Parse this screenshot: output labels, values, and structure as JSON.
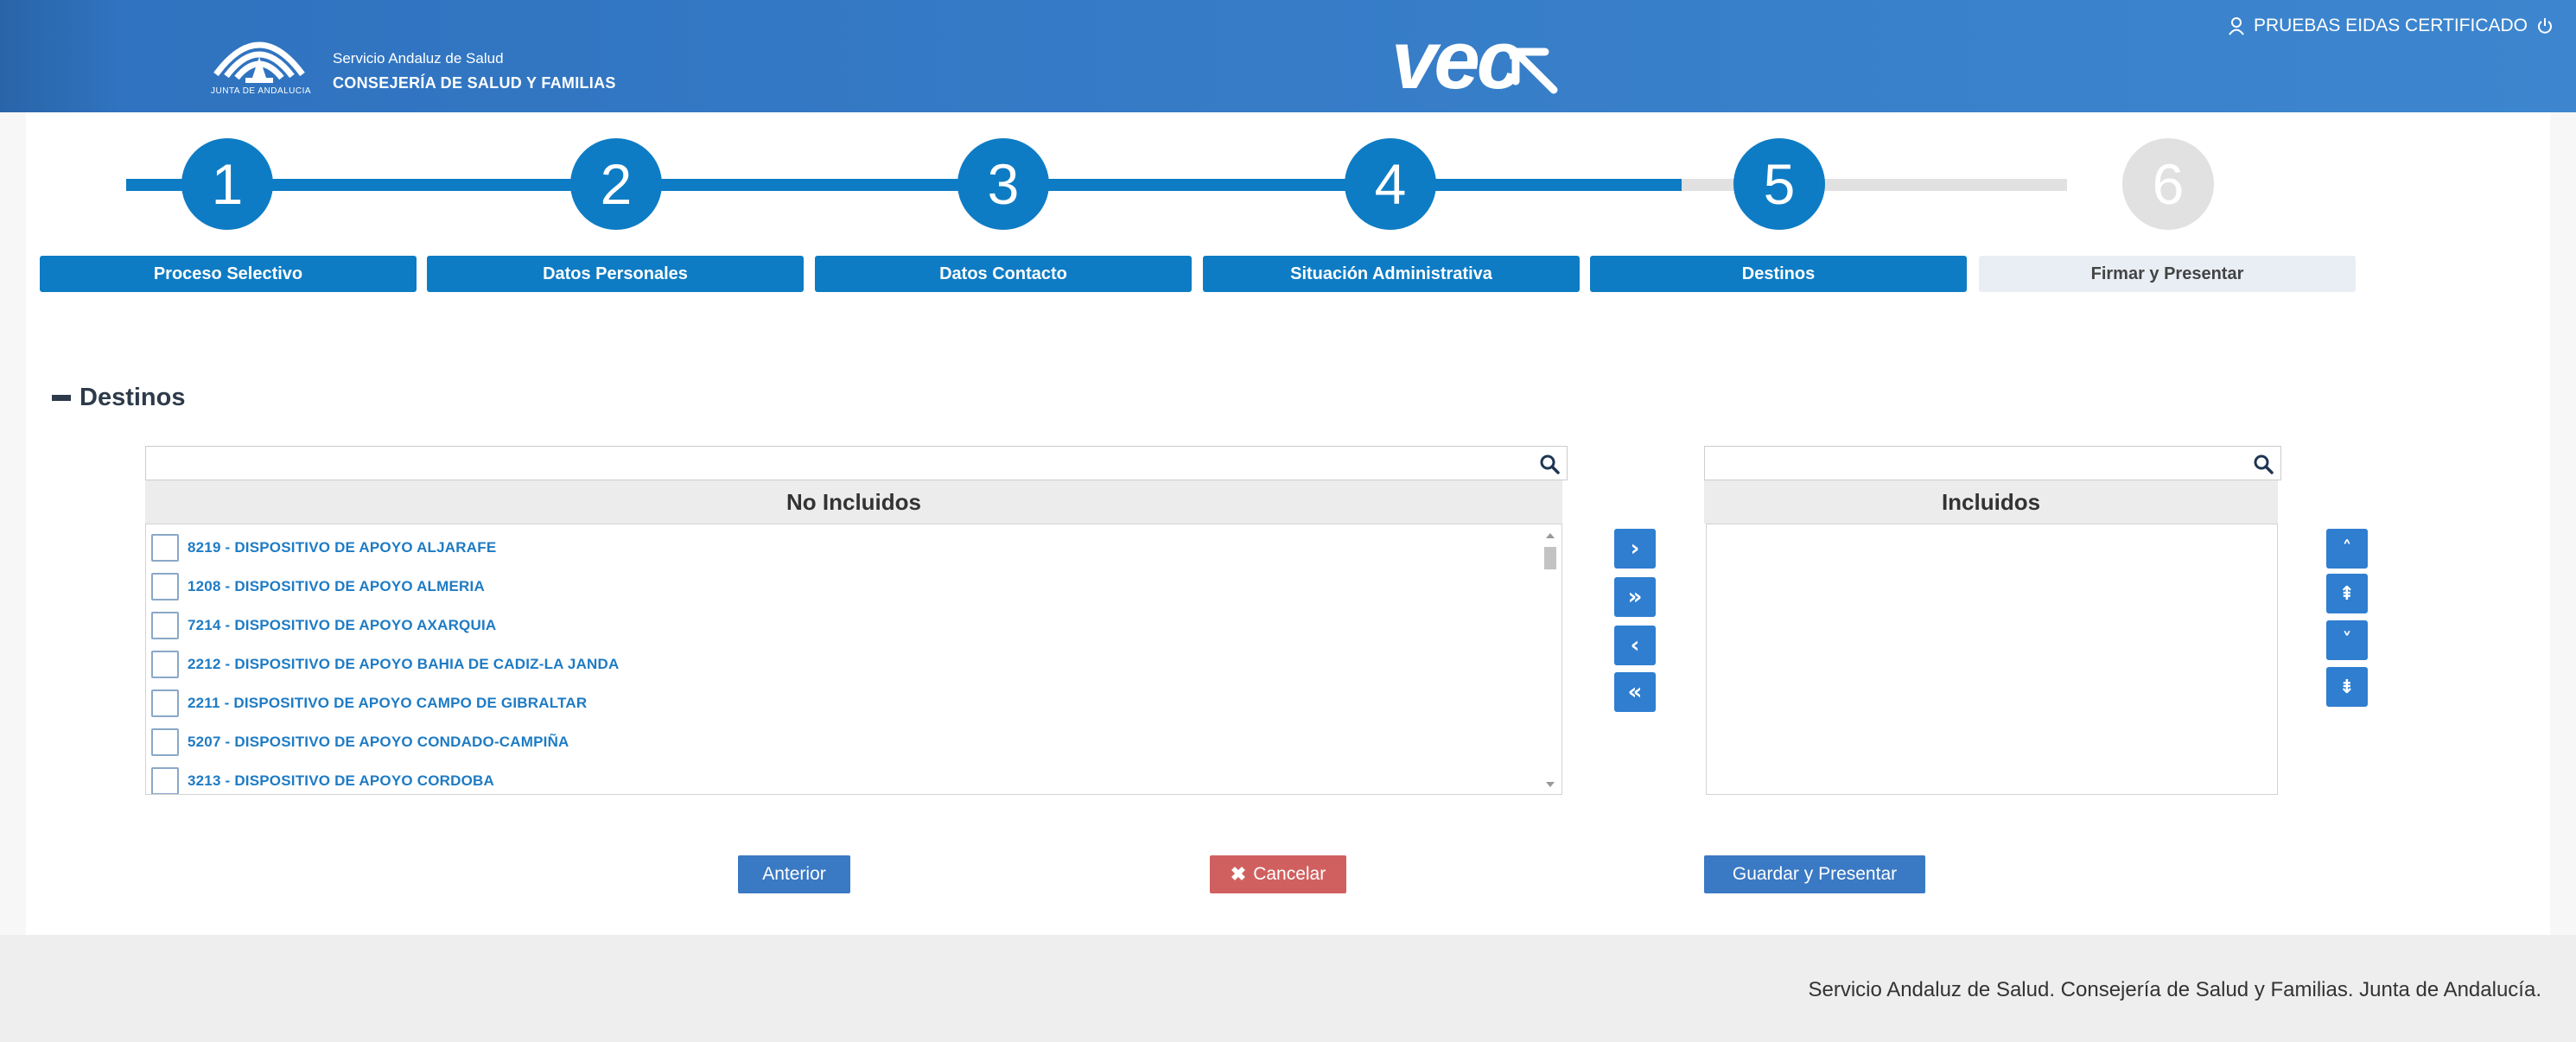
{
  "header": {
    "logo_caption": "JUNTA DE ANDALUCIA",
    "org_line1": "Servicio Andaluz de Salud",
    "org_line2": "CONSEJERÍA DE SALUD Y FAMILIAS",
    "app_logo": "vec",
    "user_name": "PRUEBAS EIDAS CERTIFICADO",
    "user_icon": "user-icon",
    "power_icon": "power-icon"
  },
  "stepper": {
    "steps": [
      {
        "number": "1",
        "label": "Proceso Selectivo",
        "state": "active"
      },
      {
        "number": "2",
        "label": "Datos Personales",
        "state": "active"
      },
      {
        "number": "3",
        "label": "Datos Contacto",
        "state": "active"
      },
      {
        "number": "4",
        "label": "Situación Administrativa",
        "state": "active"
      },
      {
        "number": "5",
        "label": "Destinos",
        "state": "active"
      },
      {
        "number": "6",
        "label": "Firmar y Presentar",
        "state": "inactive"
      }
    ],
    "active_color": "#0e7cc4",
    "inactive_color": "#e1e1e1"
  },
  "section": {
    "title": "Destinos",
    "collapse_icon": "minus-icon"
  },
  "left_list": {
    "search_value": "",
    "header": "No Incluidos",
    "items": [
      "8219 - DISPOSITIVO DE APOYO ALJARAFE",
      "1208 - DISPOSITIVO DE APOYO ALMERIA",
      "7214 - DISPOSITIVO DE APOYO AXARQUIA",
      "2212 - DISPOSITIVO DE APOYO BAHIA DE CADIZ-LA JANDA",
      "2211 - DISPOSITIVO DE APOYO CAMPO DE GIBRALTAR",
      "5207 - DISPOSITIVO DE APOYO CONDADO-CAMPIÑA",
      "3213 - DISPOSITIVO DE APOYO CORDOBA"
    ]
  },
  "right_list": {
    "search_value": "",
    "header": "Incluidos",
    "items": []
  },
  "transfer_buttons": [
    "›",
    "»",
    "‹",
    "«"
  ],
  "order_buttons": [
    "˄",
    "⇞",
    "˅",
    "⇟"
  ],
  "actions": {
    "anterior": "Anterior",
    "cancelar": "Cancelar",
    "guardar": "Guardar y Presentar"
  },
  "footer": {
    "text": "Servicio Andaluz de Salud. Consejería de Salud y Familias. Junta de Andalucía."
  }
}
